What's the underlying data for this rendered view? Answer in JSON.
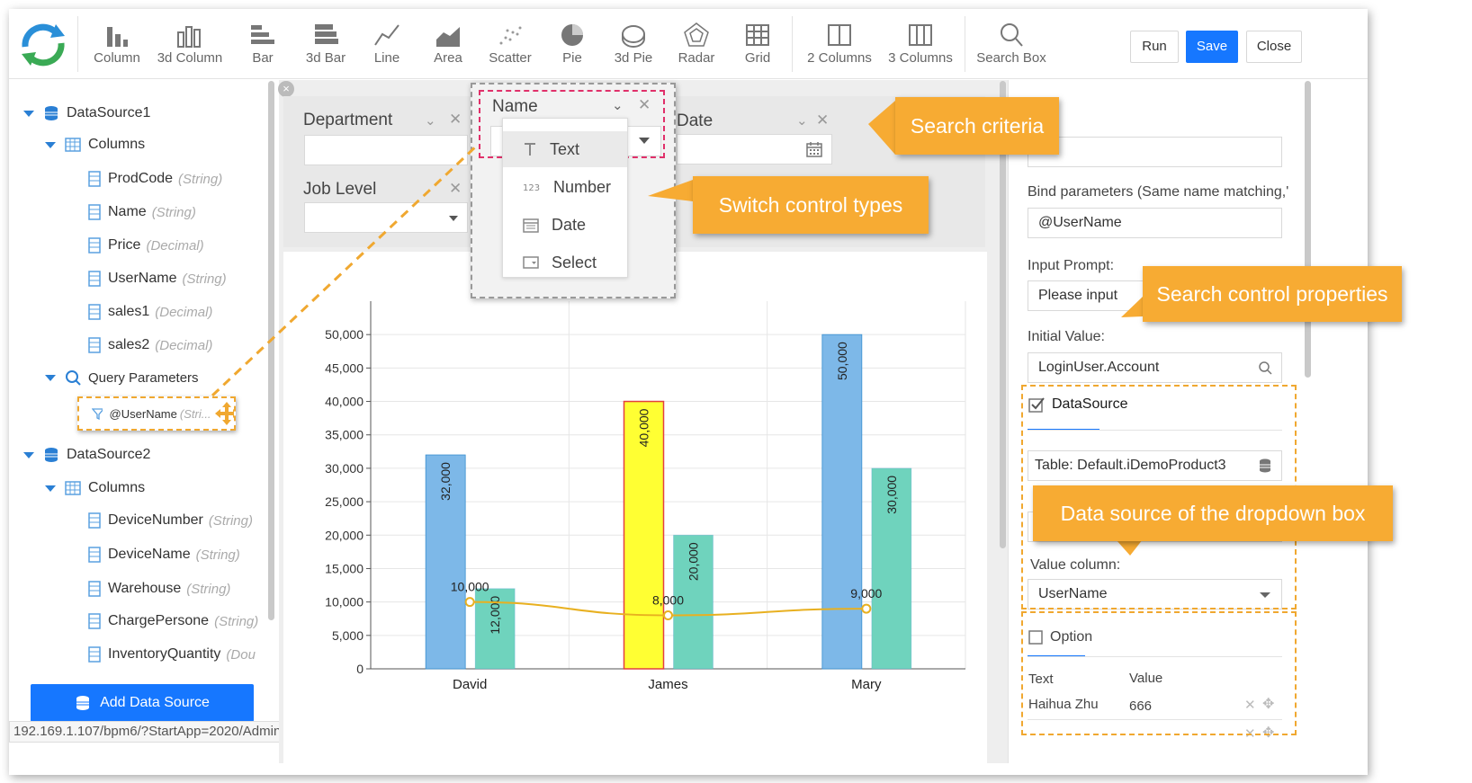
{
  "toolbar": {
    "buttons": [
      "Column",
      "3d Column",
      "Bar",
      "3d Bar",
      "Line",
      "Area",
      "Scatter",
      "Pie",
      "3d Pie",
      "Radar",
      "Grid",
      "2 Columns",
      "3 Columns",
      "Search Box"
    ],
    "run": "Run",
    "save": "Save",
    "close": "Close"
  },
  "tree": {
    "ds1": "DataSource1",
    "columns": "Columns",
    "ds1_cols": [
      {
        "name": "ProdCode",
        "type": "(String)"
      },
      {
        "name": "Name",
        "type": "(String)"
      },
      {
        "name": "Price",
        "type": "(Decimal)"
      },
      {
        "name": "UserName",
        "type": "(String)"
      },
      {
        "name": "sales1",
        "type": "(Decimal)"
      },
      {
        "name": "sales2",
        "type": "(Decimal)"
      }
    ],
    "query_params": "Query Parameters",
    "param": "@UserName",
    "param_type": "(Stri...",
    "ds2": "DataSource2",
    "ds2_cols": [
      {
        "name": "DeviceNumber",
        "type": "(String)"
      },
      {
        "name": "DeviceName",
        "type": "(String)"
      },
      {
        "name": "Warehouse",
        "type": "(String)"
      },
      {
        "name": "ChargePersone",
        "type": "(String)"
      },
      {
        "name": "InventoryQuantity",
        "type": "(Dou"
      }
    ],
    "add_ds": "Add Data Source"
  },
  "status_url": "192.169.1.107/bpm6/?StartApp=2020/Admin#",
  "search": {
    "department": "Department",
    "job_level": "Job Level",
    "name": "Name",
    "date": "Date"
  },
  "dropdown": {
    "items": [
      "Text",
      "Number",
      "Date",
      "Select"
    ]
  },
  "callouts": {
    "criteria": "Search criteria",
    "switch": "Switch control types",
    "props": "Search control properties",
    "datasource": "Data source of the dropdown box"
  },
  "right": {
    "bind_label": "Bind parameters (Same name matching,'",
    "bind_value": "@UserName",
    "prompt_label": "Input Prompt:",
    "prompt_value": "Please input",
    "initial_label": "Initial Value:",
    "initial_value": "LoginUser.Account",
    "ds_tab": "DataSource",
    "table_value": "Table: Default.iDemoProduct3",
    "value_col_label": "Value column:",
    "value_col_value": "UserName",
    "option_tab": "Option",
    "col_text": "Text",
    "col_value": "Value",
    "opt_text": "Haihua Zhu",
    "opt_value": "666"
  },
  "chart_data": {
    "type": "bar",
    "categories": [
      "David",
      "James",
      "Mary"
    ],
    "series": [
      {
        "values": [
          32000,
          40000,
          50000
        ],
        "color": "#7db8e8"
      },
      {
        "values": [
          12000,
          20000,
          30000
        ],
        "color": "#6fd3bd"
      }
    ],
    "line": {
      "values": [
        10000,
        8000,
        9000
      ],
      "color": "#e8b020"
    },
    "bar_labels": [
      [
        "32,000",
        "40,000",
        "50,000"
      ],
      [
        "12,000",
        "20,000",
        "30,000"
      ]
    ],
    "line_labels": [
      "10,000",
      "8,000",
      "9,000"
    ],
    "highlight_color": "#ffff33",
    "yticks": [
      "0",
      "5,000",
      "10,000",
      "15,000",
      "20,000",
      "25,000",
      "30,000",
      "35,000",
      "40,000",
      "45,000",
      "50,000"
    ],
    "ylim": [
      0,
      55000
    ],
    "grid": true
  }
}
